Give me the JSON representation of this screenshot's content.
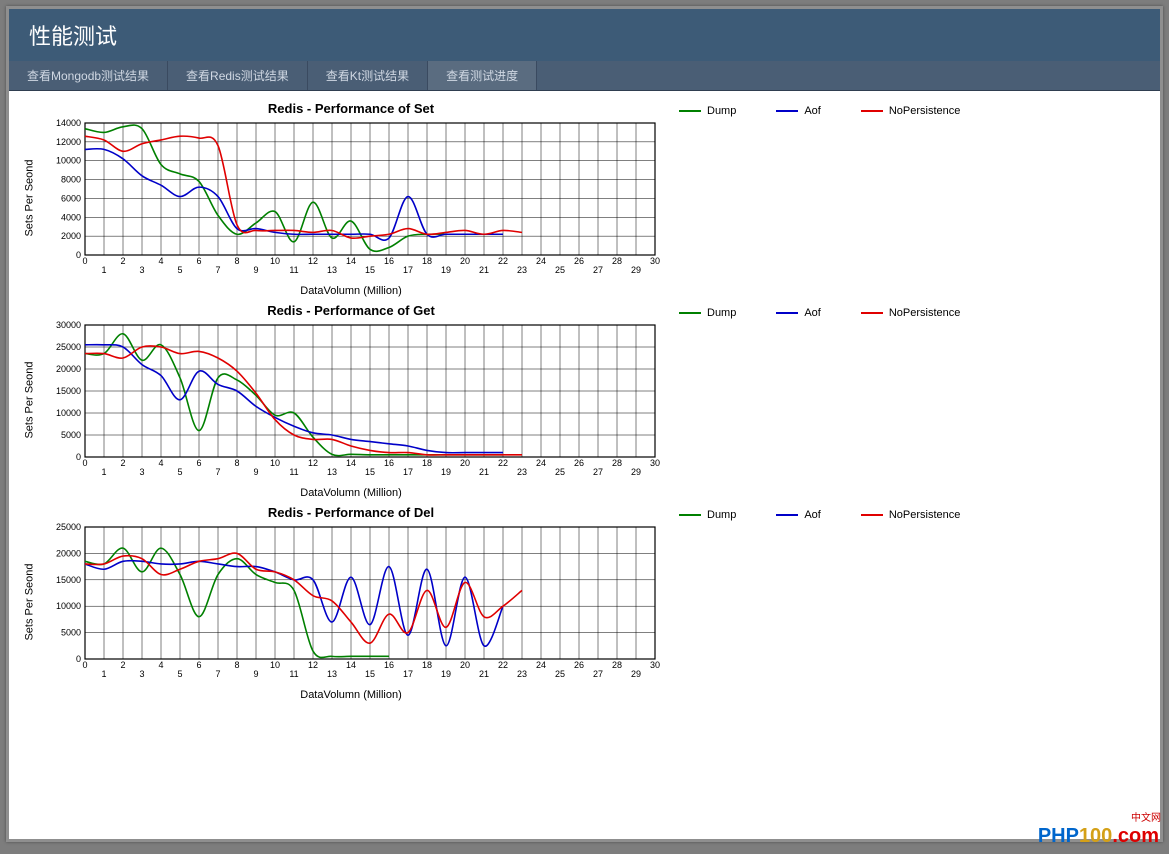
{
  "header": {
    "title": "性能测试"
  },
  "nav": {
    "items": [
      "查看Mongodb测试结果",
      "查看Redis测试结果",
      "查看Kt测试结果",
      "查看测试进度"
    ],
    "active": 3
  },
  "legend": {
    "series": [
      {
        "name": "Dump",
        "color": "#008000"
      },
      {
        "name": "Aof",
        "color": "#0000c8"
      },
      {
        "name": "NoPersistence",
        "color": "#e00000"
      }
    ]
  },
  "xlabel": "DataVolumn (Million)",
  "ylabel": "Sets Per Seond",
  "watermark": {
    "top": "中文网",
    "main_a": "PHP",
    "main_b": "100",
    "main_c": ".com"
  },
  "chart_data": [
    {
      "type": "line",
      "title": "Redis - Performance of Set",
      "xlabel": "DataVolumn (Million)",
      "ylabel": "Sets Per Seond",
      "x_range": [
        0,
        30
      ],
      "y_range": [
        0,
        14000
      ],
      "x_ticks": [
        0,
        1,
        2,
        3,
        4,
        5,
        6,
        7,
        8,
        9,
        10,
        11,
        12,
        13,
        14,
        15,
        16,
        17,
        18,
        19,
        20,
        21,
        22,
        23,
        24,
        25,
        26,
        27,
        28,
        29,
        30
      ],
      "y_ticks": [
        0,
        2000,
        4000,
        6000,
        8000,
        10000,
        12000,
        14000
      ],
      "x": [
        0,
        1,
        2,
        3,
        4,
        5,
        6,
        7,
        8,
        9,
        10,
        11,
        12,
        13,
        14,
        15,
        16,
        17,
        18,
        19,
        20,
        21,
        22,
        23
      ],
      "series": [
        {
          "name": "Dump",
          "color": "#008000",
          "values": [
            13400,
            13000,
            13600,
            13400,
            9600,
            8600,
            7800,
            4200,
            2200,
            3400,
            4600,
            1400,
            5600,
            1800,
            3600,
            600,
            800,
            2000,
            2200,
            2200,
            2200,
            2200,
            2200,
            null
          ]
        },
        {
          "name": "Aof",
          "color": "#0000c8",
          "values": [
            11200,
            11200,
            10200,
            8400,
            7400,
            6200,
            7200,
            6200,
            2800,
            2800,
            2400,
            2200,
            2200,
            2200,
            2200,
            2200,
            1800,
            6200,
            2200,
            2200,
            2200,
            2200,
            2200,
            null
          ]
        },
        {
          "name": "NoPersistence",
          "color": "#e00000",
          "values": [
            12600,
            12200,
            11000,
            11800,
            12200,
            12600,
            12400,
            11600,
            3200,
            2600,
            2600,
            2600,
            2400,
            2600,
            1800,
            2000,
            2200,
            2800,
            2200,
            2400,
            2600,
            2200,
            2600,
            2400
          ]
        }
      ]
    },
    {
      "type": "line",
      "title": "Redis - Performance of Get",
      "xlabel": "DataVolumn (Million)",
      "ylabel": "Sets Per Seond",
      "x_range": [
        0,
        30
      ],
      "y_range": [
        0,
        30000
      ],
      "x_ticks": [
        0,
        1,
        2,
        3,
        4,
        5,
        6,
        7,
        8,
        9,
        10,
        11,
        12,
        13,
        14,
        15,
        16,
        17,
        18,
        19,
        20,
        21,
        22,
        23,
        24,
        25,
        26,
        27,
        28,
        29,
        30
      ],
      "y_ticks": [
        0,
        5000,
        10000,
        15000,
        20000,
        25000,
        30000
      ],
      "x": [
        0,
        1,
        2,
        3,
        4,
        5,
        6,
        7,
        8,
        9,
        10,
        11,
        12,
        13,
        14,
        15,
        16,
        17,
        18,
        19,
        20,
        21,
        22,
        23
      ],
      "series": [
        {
          "name": "Dump",
          "color": "#008000",
          "values": [
            23500,
            23500,
            28000,
            22000,
            25500,
            18000,
            6000,
            18000,
            17500,
            14000,
            9500,
            10000,
            4500,
            600,
            600,
            500,
            500,
            500,
            500,
            500,
            500,
            500,
            500,
            null
          ]
        },
        {
          "name": "Aof",
          "color": "#0000c8",
          "values": [
            25500,
            25500,
            25000,
            21000,
            18500,
            13000,
            19500,
            16500,
            15000,
            11500,
            9000,
            7000,
            5500,
            5000,
            4000,
            3500,
            3000,
            2500,
            1500,
            1000,
            1000,
            1000,
            1000,
            null
          ]
        },
        {
          "name": "NoPersistence",
          "color": "#e00000",
          "values": [
            23500,
            23500,
            22500,
            25000,
            25000,
            23500,
            24000,
            22500,
            19500,
            14500,
            8500,
            5000,
            4000,
            4000,
            2500,
            1500,
            1000,
            1000,
            500,
            500,
            500,
            500,
            500,
            500
          ]
        }
      ]
    },
    {
      "type": "line",
      "title": "Redis - Performance of Del",
      "xlabel": "DataVolumn (Million)",
      "ylabel": "Sets Per Seond",
      "x_range": [
        0,
        30
      ],
      "y_range": [
        0,
        25000
      ],
      "x_ticks": [
        0,
        1,
        2,
        3,
        4,
        5,
        6,
        7,
        8,
        9,
        10,
        11,
        12,
        13,
        14,
        15,
        16,
        17,
        18,
        19,
        20,
        21,
        22,
        23,
        24,
        25,
        26,
        27,
        28,
        29,
        30
      ],
      "y_ticks": [
        0,
        5000,
        10000,
        15000,
        20000,
        25000
      ],
      "x": [
        0,
        1,
        2,
        3,
        4,
        5,
        6,
        7,
        8,
        9,
        10,
        11,
        12,
        13,
        14,
        15,
        16,
        17,
        18,
        19,
        20,
        21,
        22,
        23
      ],
      "series": [
        {
          "name": "Dump",
          "color": "#008000",
          "values": [
            18500,
            18000,
            21000,
            16500,
            21000,
            16000,
            8000,
            16000,
            19000,
            16000,
            14500,
            13000,
            1500,
            500,
            500,
            500,
            500,
            null,
            null,
            null,
            null,
            null,
            null,
            null
          ]
        },
        {
          "name": "Aof",
          "color": "#0000c8",
          "values": [
            18000,
            17000,
            18500,
            18500,
            18000,
            18000,
            18500,
            18000,
            17500,
            17500,
            16500,
            15000,
            15000,
            7000,
            15500,
            6500,
            17500,
            4500,
            17000,
            2500,
            15500,
            2500,
            10000,
            null
          ]
        },
        {
          "name": "NoPersistence",
          "color": "#e00000",
          "values": [
            18000,
            18000,
            19500,
            19000,
            16000,
            17000,
            18500,
            19000,
            20000,
            17000,
            16500,
            15000,
            12000,
            11000,
            7000,
            3000,
            8500,
            5000,
            13000,
            6000,
            14500,
            8000,
            10000,
            13000
          ]
        }
      ]
    }
  ]
}
